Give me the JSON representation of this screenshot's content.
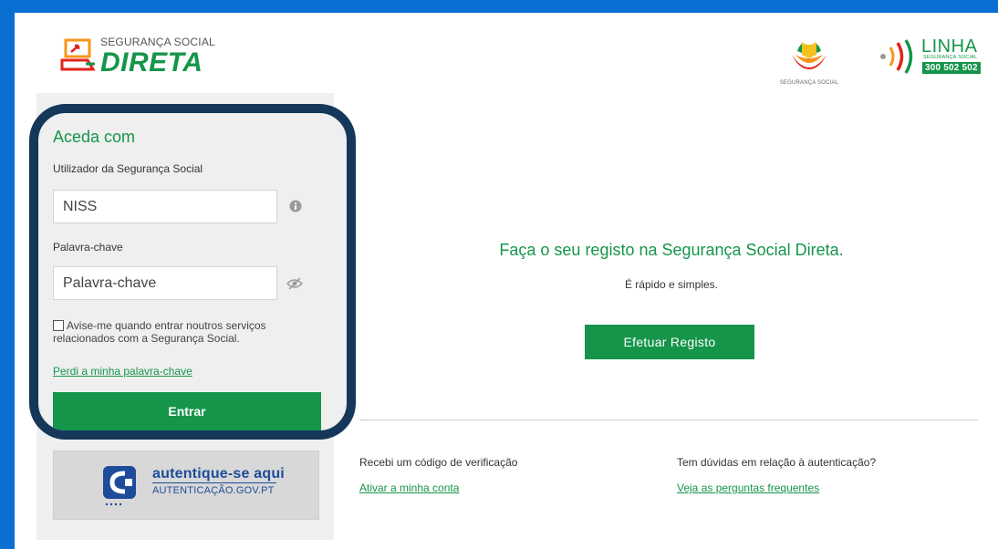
{
  "header": {
    "logo_small": "SEGURANÇA SOCIAL",
    "logo_big": "DIRETA",
    "seg_social_label": "SEGURANÇA SOCIAL",
    "linha_title": "LINHA",
    "linha_sub": "SEGURANÇA SOCIAL",
    "linha_phone": "300 502 502"
  },
  "login": {
    "heading": "Aceda com",
    "user_label": "Utilizador da Segurança Social",
    "niss_placeholder": "NISS",
    "password_label": "Palavra-chave",
    "password_placeholder": "Palavra-chave",
    "remember_label": "Avise-me quando entrar noutros serviços relacionados com a Segurança Social.",
    "remember_checked": false,
    "lost_password": "Perdi a minha palavra-chave",
    "submit_label": "Entrar"
  },
  "auth": {
    "line1": "autentique-se aqui",
    "line2": "AUTENTICAÇÃO.GOV.PT"
  },
  "register": {
    "title": "Faça o seu registo na Segurança Social Direta.",
    "subtitle": "É rápido e simples.",
    "button": "Efetuar Registo"
  },
  "footer_links": {
    "q1": "Recebi um código de verificação",
    "a1": "Ativar a minha conta",
    "q2": "Tem dúvidas em relação à autenticação?",
    "a2": "Veja as perguntas frequentes"
  },
  "colors": {
    "brand_green": "#15954a",
    "frame_blue": "#0a6fd2",
    "highlight_navy": "#14375a",
    "auth_blue": "#1e4c9a"
  }
}
